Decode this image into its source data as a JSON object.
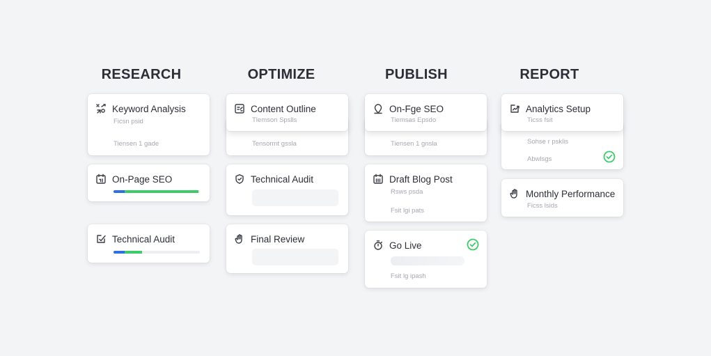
{
  "columns": [
    {
      "title": "RESEARCH",
      "cards": [
        {
          "title": "Keyword Analysis",
          "icon": "keyword-icon",
          "lines": [
            "Ficsn psid",
            "Tiensen 1 gade"
          ]
        },
        {
          "title": "On-Page SEO",
          "icon": "calendar-icon",
          "progress": 0.98
        },
        {
          "title": "Technical Audit",
          "icon": "edit-check-icon",
          "progress": 0.33
        }
      ]
    },
    {
      "title": "OPTIMIZE",
      "cards": [
        {
          "title": "Content Outline",
          "icon": "outline-icon",
          "lines": [
            "Tlemson Spslls",
            "Tensormt gssla"
          ]
        },
        {
          "title": "Technical Audit",
          "icon": "shield-icon"
        },
        {
          "title": "Final Review",
          "icon": "hand-icon"
        }
      ]
    },
    {
      "title": "PUBLISH",
      "cards": [
        {
          "title": "On-Fge SEO",
          "icon": "location-pin-icon",
          "lines": [
            "Tiemsas Epsdo",
            "Tiensen 1 gnsla"
          ]
        },
        {
          "title": "Draft Blog Post",
          "icon": "draft-calendar-icon",
          "lines": [
            "Rsws psda",
            "Fsit lgi pats"
          ]
        },
        {
          "title": "Go Live",
          "icon": "timer-icon",
          "lines": [
            "Fsit lg ipash"
          ],
          "done": true
        }
      ]
    },
    {
      "title": "REPORT",
      "cards": [
        {
          "title": "Analytics Setup",
          "icon": "analytics-icon",
          "lines": [
            "Ticss fsit",
            "Sohse r psklis",
            "Abwlsgs"
          ],
          "done": true
        },
        {
          "title": "Monthly Performance",
          "icon": "hand-icon",
          "lines": [
            "Ficss lsids"
          ]
        }
      ]
    }
  ],
  "colors": {
    "check": "#3ecb6a",
    "progress_start": "#2f6fe4",
    "progress_fill": "#3ecb6a"
  }
}
